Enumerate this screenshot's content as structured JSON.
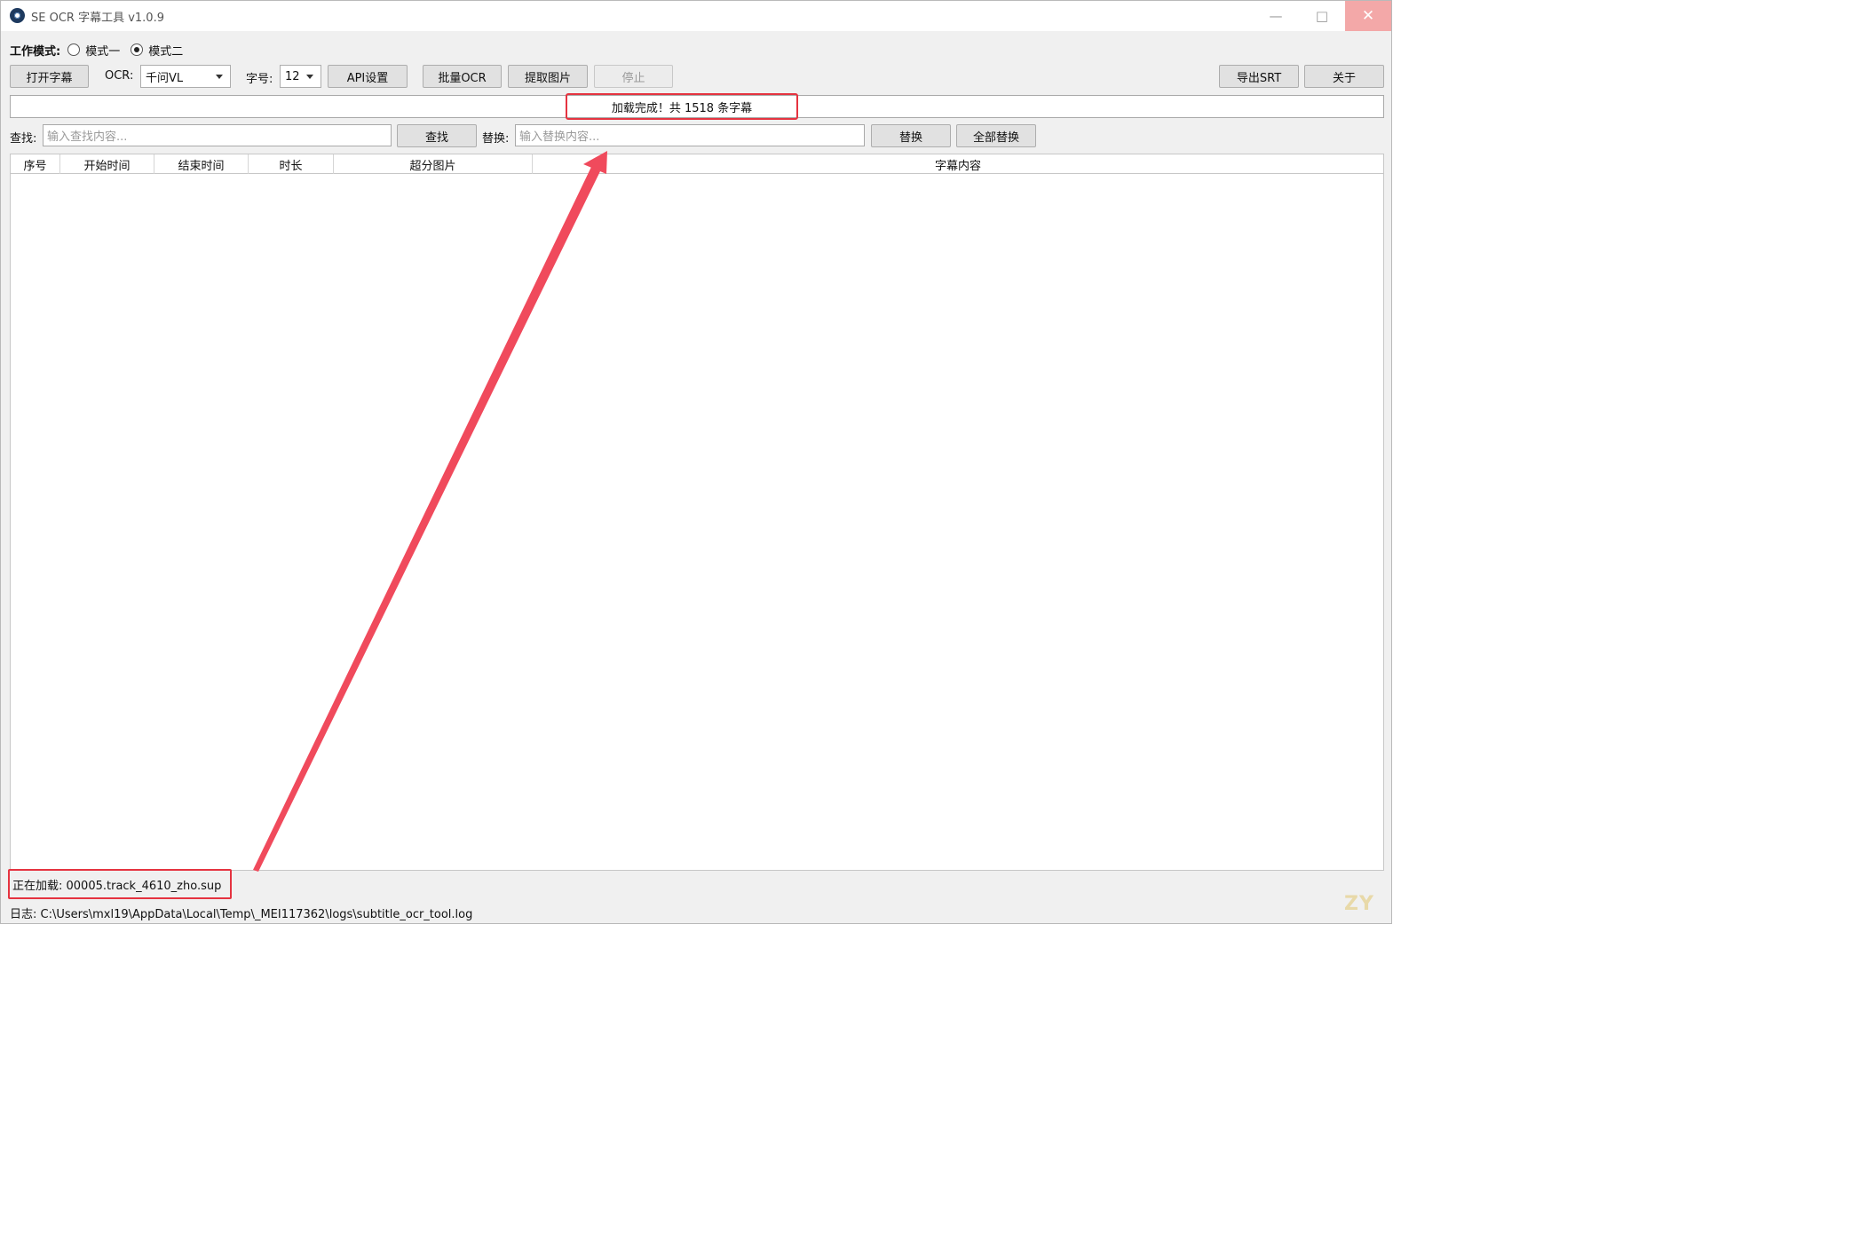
{
  "window": {
    "title": "SE OCR 字幕工具 v1.0.9",
    "minimize": "—",
    "maximize": "□",
    "close": "✕"
  },
  "mode": {
    "label": "工作模式:",
    "options": [
      {
        "label": "模式一",
        "selected": false
      },
      {
        "label": "模式二",
        "selected": true
      }
    ]
  },
  "toolbar": {
    "open_subtitle": "打开字幕",
    "ocr_label": "OCR:",
    "ocr_value": "千问VL",
    "font_size_label": "字号:",
    "font_size_value": "12",
    "api_settings": "API设置",
    "batch_ocr": "批量OCR",
    "extract_images": "提取图片",
    "stop": "停止",
    "export_srt": "导出SRT",
    "about": "关于"
  },
  "status": {
    "message": "加载完成！共 1518 条字幕"
  },
  "search": {
    "find_label": "查找:",
    "find_placeholder": "输入查找内容...",
    "find_button": "查找",
    "replace_label": "替换:",
    "replace_placeholder": "输入替换内容...",
    "replace_button": "替换",
    "replace_all_button": "全部替换"
  },
  "table": {
    "columns": [
      "序号",
      "开始时间",
      "结束时间",
      "时长",
      "超分图片",
      "字幕内容"
    ],
    "rows": []
  },
  "footer": {
    "loading": "正在加载: 00005.track_4610_zho.sup",
    "log": "日志: C:\\Users\\mxl19\\AppData\\Local\\Temp\\_MEI117362\\logs\\subtitle_ocr_tool.log"
  },
  "watermark": "ZY",
  "colors": {
    "highlight": "#e53340",
    "arrow": "#f04a5c",
    "window_bg": "#f0f0f0",
    "close_button": "#f3a8a8"
  }
}
